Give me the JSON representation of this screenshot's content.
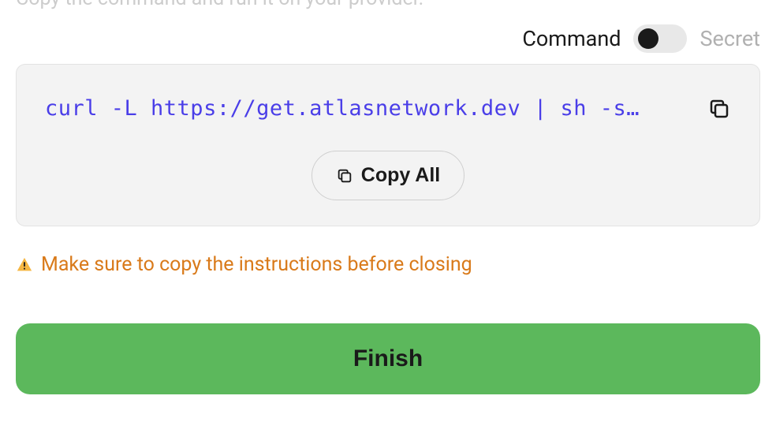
{
  "instruction": "Copy the command and run it on your provider.",
  "toggle": {
    "command_label": "Command",
    "secret_label": "Secret"
  },
  "code": {
    "command": "curl -L https://get.atlasnetwork.dev | sh -s…"
  },
  "copy_all_label": "Copy All",
  "warning_text": "Make sure to copy the instructions before closing",
  "finish_label": "Finish"
}
